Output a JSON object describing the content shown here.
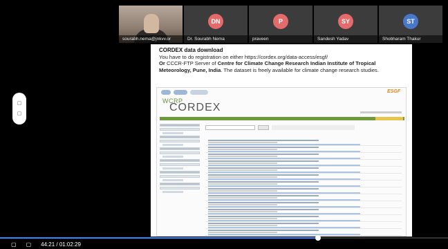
{
  "participants": [
    {
      "name": "sourabh.nema@jnkvv.or",
      "initials": "",
      "video": true,
      "color": ""
    },
    {
      "name": "Dr. Sourabh Nema",
      "initials": "DN",
      "video": false,
      "color": "#e36b6b"
    },
    {
      "name": "praveen",
      "initials": "P",
      "video": false,
      "color": "#e36b6b"
    },
    {
      "name": "Sandesh Yadav",
      "initials": "SY",
      "video": false,
      "color": "#e36b6b"
    },
    {
      "name": "Shobharam Thakur",
      "initials": "ST",
      "video": false,
      "color": "#4a78c8"
    }
  ],
  "slide": {
    "title": "CORDEX data download",
    "line1": "You have to do registration on either https://cordex.org/data-access/esgf/",
    "line2_prefix": "Or",
    "line2_mid": " CCCR-FTP Server of ",
    "line2_bold": "Centre for Climate Change Research Indian Institute of Tropical Meteorology, Pune, India",
    "line2_suffix": ". The dataset is freely available for climate change research studies."
  },
  "site": {
    "wcrp": "WCRP",
    "cordex": "CORDEX",
    "esgf": "ESGF"
  },
  "player": {
    "timecode": "44:21 / 01:02:29",
    "progress": 0.71,
    "accent": "#2d8cff"
  }
}
